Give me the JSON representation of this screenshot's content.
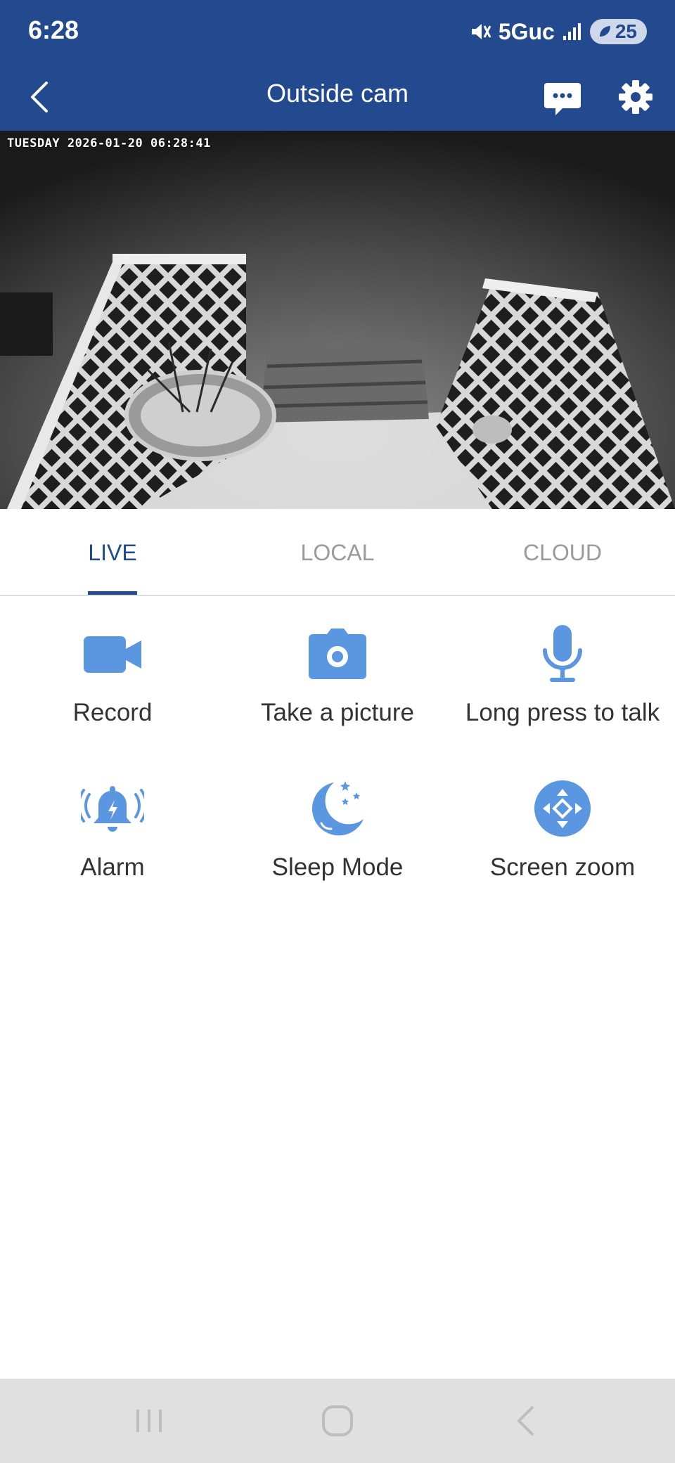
{
  "status_bar": {
    "time": "6:28",
    "network": "5Guc",
    "battery": "25"
  },
  "header": {
    "title": "Outside cam"
  },
  "video": {
    "timestamp": "TUESDAY 2026-01-20 06:28:41"
  },
  "tabs": [
    {
      "label": "LIVE",
      "active": true
    },
    {
      "label": "LOCAL",
      "active": false
    },
    {
      "label": "CLOUD",
      "active": false
    }
  ],
  "actions": [
    {
      "label": "Record",
      "icon": "video-camera-icon"
    },
    {
      "label": "Take a picture",
      "icon": "camera-icon"
    },
    {
      "label": "Long press to talk",
      "icon": "microphone-icon"
    },
    {
      "label": "Alarm",
      "icon": "alarm-bell-icon"
    },
    {
      "label": "Sleep Mode",
      "icon": "moon-stars-icon"
    },
    {
      "label": "Screen zoom",
      "icon": "zoom-arrows-icon"
    }
  ],
  "colors": {
    "brand": "#234a8f",
    "icon": "#5b96e0"
  }
}
